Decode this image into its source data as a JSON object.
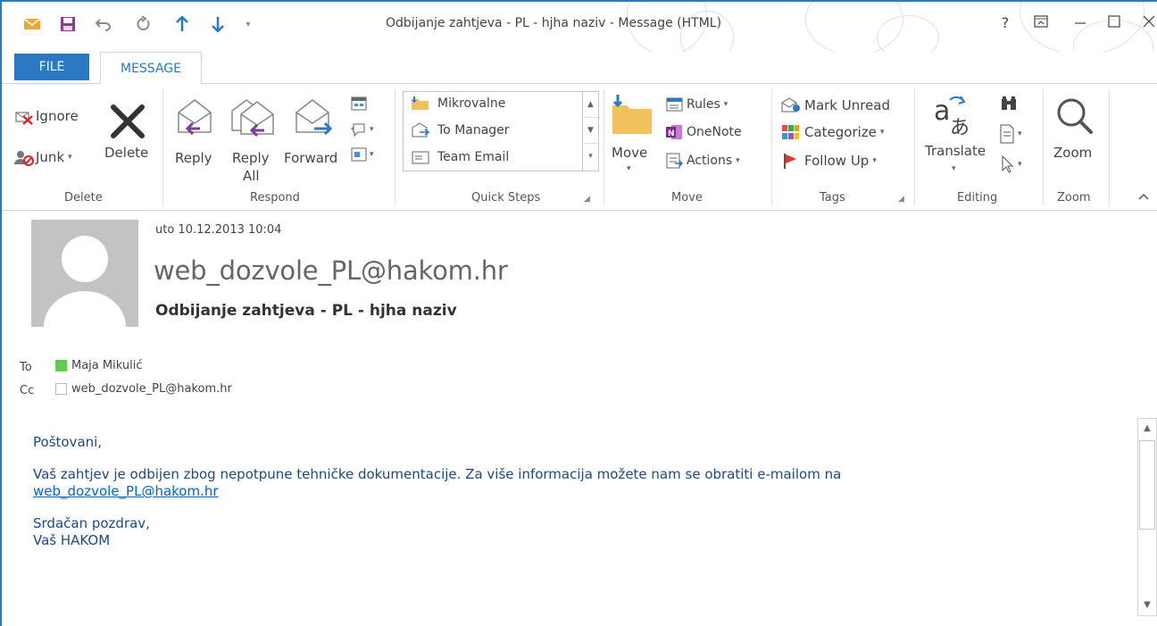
{
  "titlebar": {
    "title": "Odbijanje zahtjeva - PL - hjha naziv - Message (HTML)",
    "help": "?",
    "accent": "#2b79c2"
  },
  "tabs": [
    {
      "label": "FILE"
    },
    {
      "label": "MESSAGE"
    }
  ],
  "ribbon": {
    "delete_group": {
      "label": "Delete",
      "ignore": "Ignore",
      "junk": "Junk",
      "delete": "Delete"
    },
    "respond_group": {
      "label": "Respond",
      "reply": "Reply",
      "reply_all_line1": "Reply",
      "reply_all_line2": "All",
      "forward": "Forward"
    },
    "quick_steps_group": {
      "label": "Quick Steps",
      "items": [
        "Mikrovalne",
        "To Manager",
        "Team Email"
      ]
    },
    "move_group": {
      "label": "Move",
      "move": "Move",
      "rules": "Rules",
      "onenote": "OneNote",
      "actions": "Actions"
    },
    "tags_group": {
      "label": "Tags",
      "mark_unread": "Mark Unread",
      "categorize": "Categorize",
      "follow_up": "Follow Up"
    },
    "editing_group": {
      "label": "Editing",
      "translate": "Translate"
    },
    "zoom_group": {
      "label": "Zoom",
      "zoom": "Zoom"
    }
  },
  "header": {
    "date": "uto 10.12.2013 10:04",
    "sender": "web_dozvole_PL@hakom.hr",
    "subject": "Odbijanje zahtjeva - PL - hjha naziv",
    "to_label": "To",
    "to_value": "Maja Mikulić",
    "cc_label": "Cc",
    "cc_value": "web_dozvole_PL@hakom.hr"
  },
  "body": {
    "greeting": "Poštovani,",
    "text": "Vaš zahtjev je odbijen zbog nepotpune tehničke dokumentacije. Za više informacija možete nam se obratiti e-mailom na",
    "link": "web_dozvole_PL@hakom.hr",
    "closing1": "Srdačan pozdrav,",
    "closing2": "Vaš HAKOM"
  }
}
